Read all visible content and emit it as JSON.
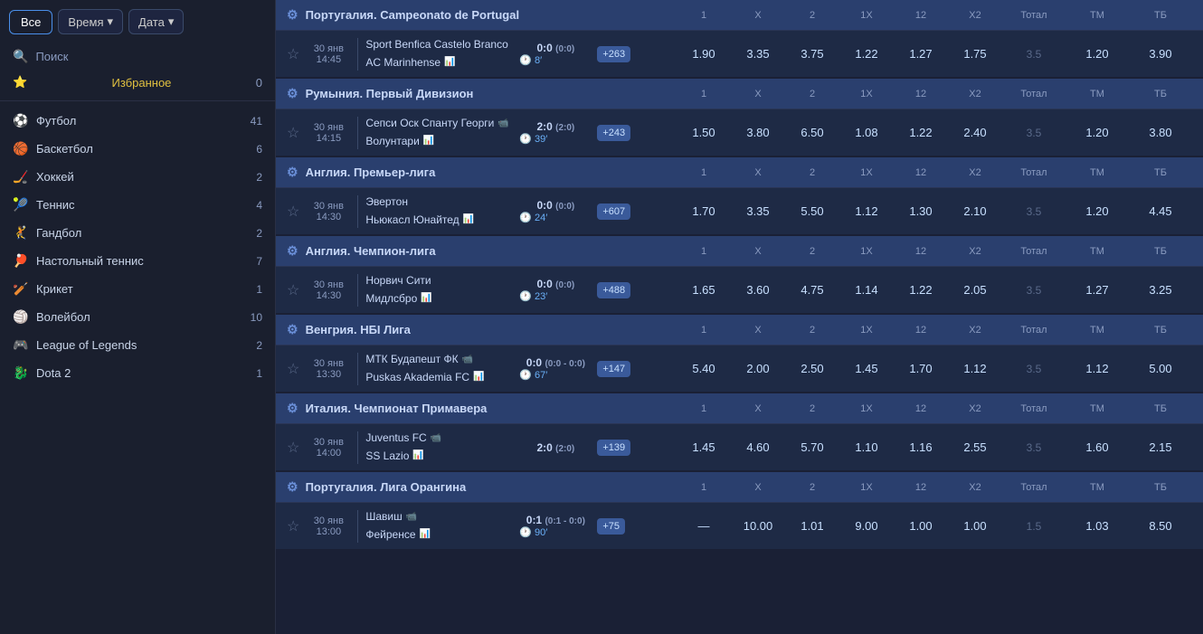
{
  "filters": {
    "all_label": "Все",
    "time_label": "Время",
    "date_label": "Дата"
  },
  "sidebar": {
    "search_label": "Поиск",
    "favorites_label": "Избранное",
    "favorites_count": "0",
    "sports": [
      {
        "id": "football",
        "icon": "⚙",
        "label": "Футбол",
        "count": "41"
      },
      {
        "id": "basketball",
        "icon": "🏀",
        "label": "Баскетбол",
        "count": "6"
      },
      {
        "id": "hockey",
        "icon": "🏒",
        "label": "Хоккей",
        "count": "2"
      },
      {
        "id": "tennis",
        "icon": "🎾",
        "label": "Теннис",
        "count": "4"
      },
      {
        "id": "handball",
        "icon": "🤾",
        "label": "Гандбол",
        "count": "2"
      },
      {
        "id": "table_tennis",
        "icon": "🏓",
        "label": "Настольный теннис",
        "count": "7"
      },
      {
        "id": "cricket",
        "icon": "🏏",
        "label": "Крикет",
        "count": "1"
      },
      {
        "id": "volleyball",
        "icon": "🏐",
        "label": "Волейбол",
        "count": "10"
      },
      {
        "id": "lol",
        "icon": "🎮",
        "label": "League of Legends",
        "count": "2"
      },
      {
        "id": "dota2",
        "icon": "⚙",
        "label": "Dota 2",
        "count": "1"
      }
    ]
  },
  "odds_headers": [
    "1",
    "X",
    "2",
    "1X",
    "12",
    "X2",
    "Тотал",
    "ТМ",
    "ТБ"
  ],
  "leagues": [
    {
      "id": "portugal_camp",
      "title": "Португалия. Campeonato de Portugal",
      "matches": [
        {
          "date": "30 янв",
          "time": "14:45",
          "team1": "Sport Benfica Castelo Branco",
          "team1_icon": "",
          "team2": "AC Marinhense",
          "team2_icon": "📊",
          "score_main": "0:0",
          "score_sub": "(0:0)",
          "live_time": "8′",
          "more": "+263",
          "odds": [
            "1.90",
            "3.35",
            "3.75",
            "1.22",
            "1.27",
            "1.75"
          ],
          "total": "3.5",
          "tm": "1.20",
          "tb": "3.90"
        }
      ]
    },
    {
      "id": "romania_div",
      "title": "Румыния. Первый Дивизион",
      "matches": [
        {
          "date": "30 янв",
          "time": "14:15",
          "team1": "Сепси Оск Спанту Георги",
          "team1_icon": "📹",
          "team2": "Волунтари",
          "team2_icon": "📊",
          "score_main": "2:0",
          "score_sub": "(2:0)",
          "live_time": "39′",
          "more": "+243",
          "odds": [
            "1.50",
            "3.80",
            "6.50",
            "1.08",
            "1.22",
            "2.40"
          ],
          "total": "3.5",
          "tm": "1.20",
          "tb": "3.80"
        }
      ]
    },
    {
      "id": "england_premier",
      "title": "Англия. Премьер-лига",
      "matches": [
        {
          "date": "30 янв",
          "time": "14:30",
          "team1": "Эвертон",
          "team1_icon": "",
          "team2": "Ньюкасл Юнайтед",
          "team2_icon": "📊",
          "score_main": "0:0",
          "score_sub": "(0:0)",
          "live_time": "24′",
          "more": "+607",
          "odds": [
            "1.70",
            "3.35",
            "5.50",
            "1.12",
            "1.30",
            "2.10"
          ],
          "total": "3.5",
          "tm": "1.20",
          "tb": "4.45"
        }
      ]
    },
    {
      "id": "england_champ",
      "title": "Англия. Чемпион-лига",
      "matches": [
        {
          "date": "30 янв",
          "time": "14:30",
          "team1": "Норвич Сити",
          "team1_icon": "",
          "team2": "Мидлсбро",
          "team2_icon": "📊",
          "score_main": "0:0",
          "score_sub": "(0:0)",
          "live_time": "23′",
          "more": "+488",
          "odds": [
            "1.65",
            "3.60",
            "4.75",
            "1.14",
            "1.22",
            "2.05"
          ],
          "total": "3.5",
          "tm": "1.27",
          "tb": "3.25"
        }
      ]
    },
    {
      "id": "hungary_nbi",
      "title": "Венгрия. НБI Лига",
      "matches": [
        {
          "date": "30 янв",
          "time": "13:30",
          "team1": "МТК Будапешт ФК",
          "team1_icon": "📹",
          "team2": "Puskas Akademia FC",
          "team2_icon": "📊",
          "score_main": "0:0",
          "score_sub": "(0:0 - 0:0)",
          "live_time": "67′",
          "more": "+147",
          "odds": [
            "5.40",
            "2.00",
            "2.50",
            "1.45",
            "1.70",
            "1.12"
          ],
          "total": "3.5",
          "tm": "1.12",
          "tb": "5.00"
        }
      ]
    },
    {
      "id": "italy_primavera",
      "title": "Италия. Чемпионат Примавера",
      "matches": [
        {
          "date": "30 янв",
          "time": "14:00",
          "team1": "Juventus FC",
          "team1_icon": "📹",
          "team2": "SS Lazio",
          "team2_icon": "📊",
          "score_main": "2:0",
          "score_sub": "(2:0)",
          "live_time": "",
          "more": "+139",
          "odds": [
            "1.45",
            "4.60",
            "5.70",
            "1.10",
            "1.16",
            "2.55"
          ],
          "total": "3.5",
          "tm": "1.60",
          "tb": "2.15"
        }
      ]
    },
    {
      "id": "portugal_laranjina",
      "title": "Португалия. Лига Орангина",
      "matches": [
        {
          "date": "30 янв",
          "time": "13:00",
          "team1": "Шавиш",
          "team1_icon": "📹",
          "team2": "Фейренсе",
          "team2_icon": "📊",
          "score_main": "0:1",
          "score_sub": "(0:1 - 0:0)",
          "live_time": "90′",
          "more": "+75",
          "odds": [
            "—",
            "10.00",
            "1.01",
            "9.00",
            "1.00",
            "1.00"
          ],
          "total": "1.5",
          "tm": "1.03",
          "tb": "8.50"
        }
      ]
    }
  ]
}
